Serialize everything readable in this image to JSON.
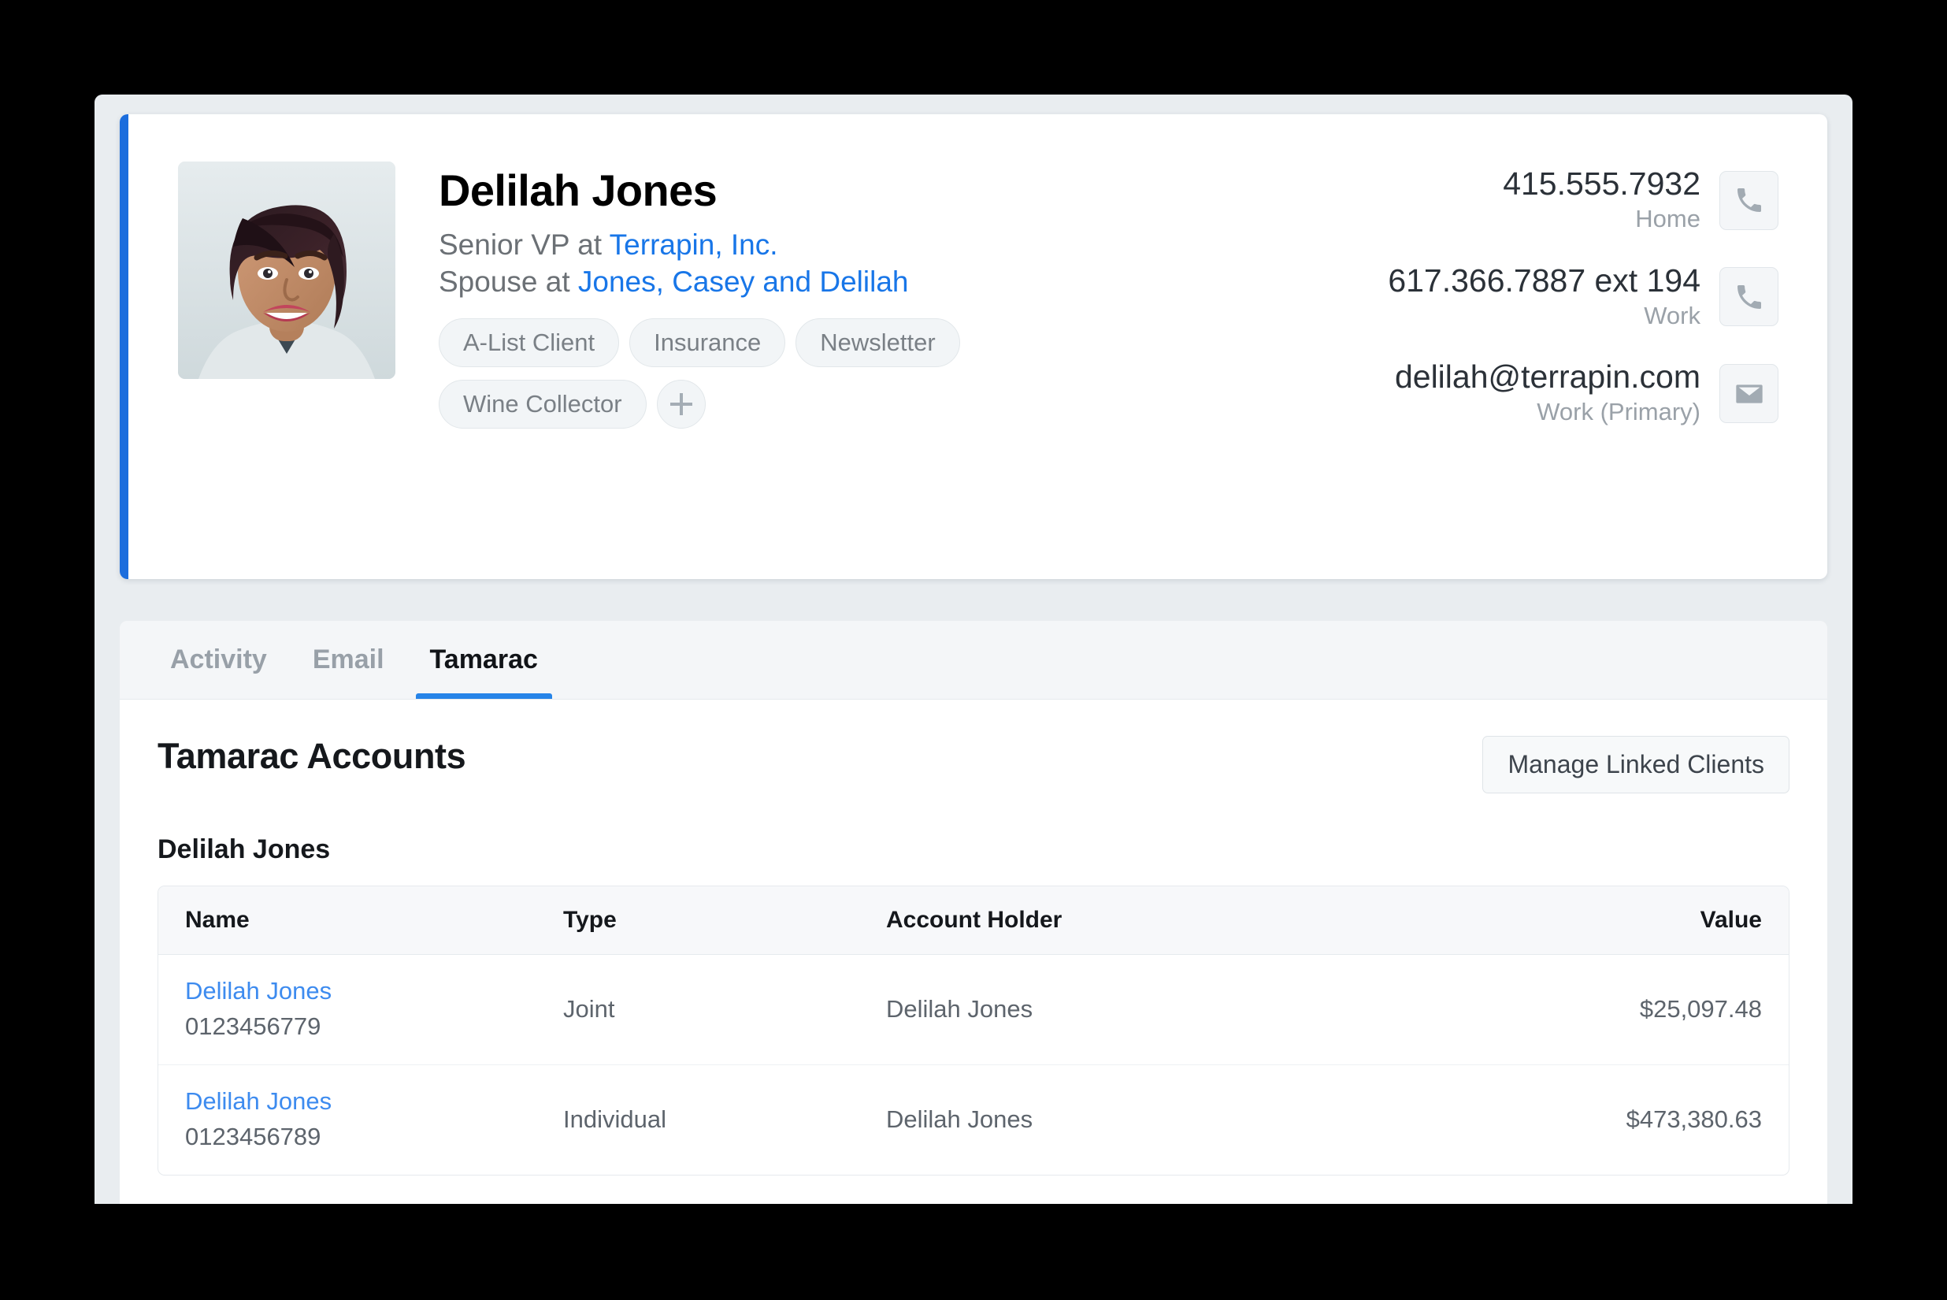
{
  "profile": {
    "accent_color": "#1b6ddd",
    "name": "Delilah Jones",
    "roles": [
      {
        "prefix": "Senior VP at ",
        "company": "Terrapin, Inc."
      },
      {
        "prefix": "Spouse at ",
        "company": "Jones, Casey and Delilah"
      }
    ],
    "tags": [
      "A-List Client",
      "Insurance",
      "Newsletter",
      "Wine Collector"
    ],
    "add_tag_icon": "plus-icon",
    "contacts": [
      {
        "value": "415.555.7932",
        "label": "Home",
        "icon": "phone-icon"
      },
      {
        "value": "617.366.7887 ext 194",
        "label": "Work",
        "icon": "phone-icon"
      },
      {
        "value": "delilah@terrapin.com",
        "label": "Work (Primary)",
        "icon": "envelope-icon"
      }
    ]
  },
  "tabs": [
    {
      "label": "Activity",
      "active": false
    },
    {
      "label": "Email",
      "active": false
    },
    {
      "label": "Tamarac",
      "active": true
    }
  ],
  "panel": {
    "section_title": "Tamarac Accounts",
    "manage_button_label": "Manage Linked Clients",
    "group_title": "Delilah Jones",
    "table": {
      "headers": [
        "Name",
        "Type",
        "Account Holder",
        "Value"
      ],
      "rows": [
        {
          "name": "Delilah Jones",
          "number": "0123456779",
          "type": "Joint",
          "holder": "Delilah Jones",
          "value": "$25,097.48"
        },
        {
          "name": "Delilah Jones",
          "number": "0123456789",
          "type": "Individual",
          "holder": "Delilah Jones",
          "value": "$473,380.63"
        }
      ]
    }
  }
}
